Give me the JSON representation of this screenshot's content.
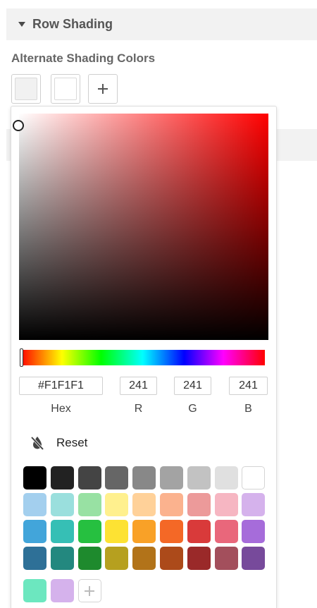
{
  "section": {
    "title": "Row Shading",
    "icon": "caret-down-icon"
  },
  "alternate": {
    "label": "Alternate Shading Colors",
    "swatches": [
      "#F1F1F1",
      "#FFFFFF"
    ],
    "add_icon": "plus-icon"
  },
  "picker": {
    "hue_color": "#FF0000",
    "hex": "#F1F1F1",
    "r": "241",
    "g": "241",
    "b": "241",
    "labels": {
      "hex": "Hex",
      "r": "R",
      "g": "G",
      "b": "B"
    },
    "reset_label": "Reset",
    "reset_icon": "no-color-drop-icon",
    "palette": [
      [
        "#000000",
        "#222222",
        "#444444",
        "#666666",
        "#888888",
        "#A3A3A3",
        "#C2C2C2",
        "#E0E0E0",
        "#FFFFFF"
      ],
      [
        "#A3CFEE",
        "#9ADFDD",
        "#98E1A3",
        "#FFF08E",
        "#FFD199",
        "#FBB28E",
        "#EC9A9A",
        "#F6B6C2",
        "#D5B2EC"
      ],
      [
        "#42A5DA",
        "#36BFB5",
        "#26C040",
        "#FDE233",
        "#F9A127",
        "#F46826",
        "#D93A3A",
        "#E9677B",
        "#A66CDA"
      ],
      [
        "#2E7097",
        "#23887F",
        "#1E8A2D",
        "#B6A01F",
        "#B27319",
        "#AC4A1A",
        "#9A2929",
        "#A34F5C",
        "#774A9B"
      ]
    ],
    "custom_colors": [
      "#6CE7BF",
      "#D5B2EC"
    ]
  }
}
